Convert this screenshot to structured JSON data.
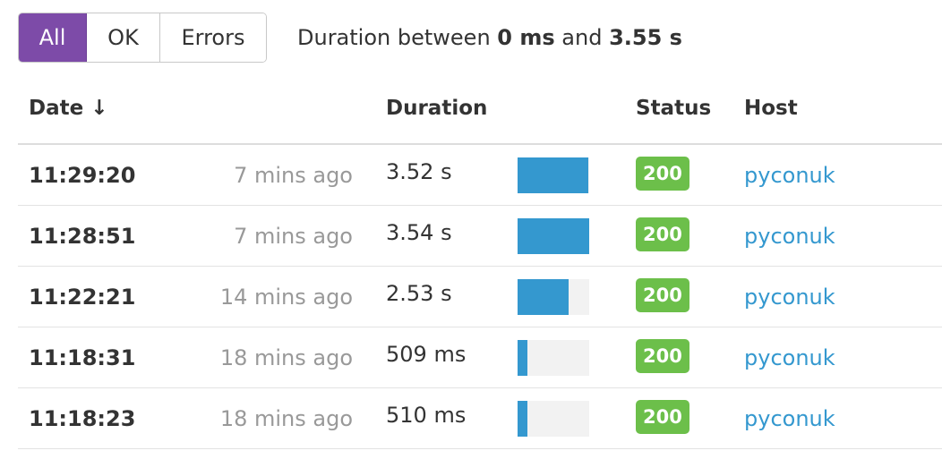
{
  "filters": {
    "buttons": [
      {
        "label": "All",
        "active": true
      },
      {
        "label": "OK",
        "active": false
      },
      {
        "label": "Errors",
        "active": false
      }
    ],
    "duration_prefix": "Duration between",
    "duration_min": "0 ms",
    "duration_and": "and",
    "duration_max": "3.55 s"
  },
  "table": {
    "headers": {
      "date": "Date",
      "sort_indicator": "↓",
      "duration": "Duration",
      "status": "Status",
      "host": "Host"
    },
    "rows": [
      {
        "time": "11:29:20",
        "ago": "7 mins ago",
        "duration": "3.52 s",
        "bar_fraction": 0.99,
        "status": "200",
        "host": "pyconuk"
      },
      {
        "time": "11:28:51",
        "ago": "7 mins ago",
        "duration": "3.54 s",
        "bar_fraction": 1.0,
        "status": "200",
        "host": "pyconuk"
      },
      {
        "time": "11:22:21",
        "ago": "14 mins ago",
        "duration": "2.53 s",
        "bar_fraction": 0.71,
        "status": "200",
        "host": "pyconuk"
      },
      {
        "time": "11:18:31",
        "ago": "18 mins ago",
        "duration": "509 ms",
        "bar_fraction": 0.14,
        "status": "200",
        "host": "pyconuk"
      },
      {
        "time": "11:18:23",
        "ago": "18 mins ago",
        "duration": "510 ms",
        "bar_fraction": 0.14,
        "status": "200",
        "host": "pyconuk"
      }
    ]
  },
  "colors": {
    "accent": "#7d4ba8",
    "bar": "#3498cf",
    "status_ok": "#6cbf4a",
    "link": "#3498cf"
  }
}
